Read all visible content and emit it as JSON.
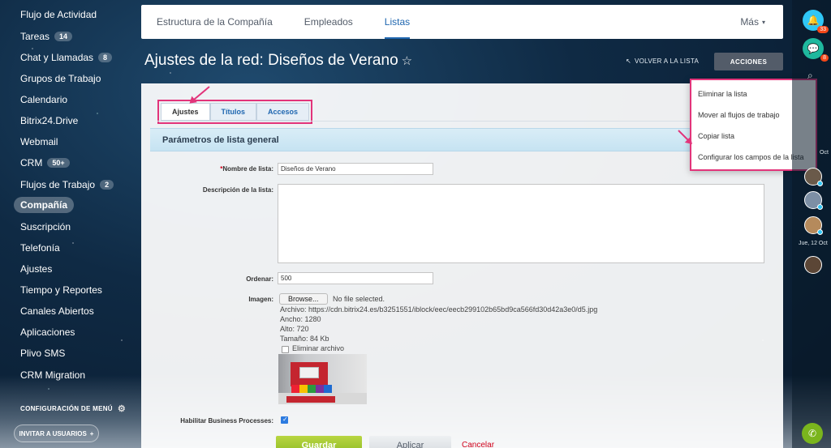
{
  "sidebar": {
    "items": [
      {
        "label": "Flujo de Actividad",
        "badge": ""
      },
      {
        "label": "Tareas",
        "badge": "14"
      },
      {
        "label": "Chat y Llamadas",
        "badge": "8"
      },
      {
        "label": "Grupos de Trabajo",
        "badge": ""
      },
      {
        "label": "Calendario",
        "badge": ""
      },
      {
        "label": "Bitrix24.Drive",
        "badge": ""
      },
      {
        "label": "Webmail",
        "badge": ""
      },
      {
        "label": "CRM",
        "badge": "50+"
      },
      {
        "label": "Flujos de Trabajo",
        "badge": "2"
      },
      {
        "label": "Compañía",
        "badge": ""
      },
      {
        "label": "Suscripción",
        "badge": ""
      },
      {
        "label": "Telefonía",
        "badge": ""
      },
      {
        "label": "Ajustes",
        "badge": ""
      },
      {
        "label": "Tiempo y Reportes",
        "badge": ""
      },
      {
        "label": "Canales Abiertos",
        "badge": ""
      },
      {
        "label": "Aplicaciones",
        "badge": ""
      },
      {
        "label": "Plivo SMS",
        "badge": ""
      },
      {
        "label": "CRM Migration",
        "badge": ""
      }
    ],
    "active_index": 9,
    "menu_settings": "CONFIGURACIÓN DE MENÚ",
    "invite": "INVITAR A USUARIOS",
    "invite_plus": "+"
  },
  "topnav": {
    "tabs": [
      "Estructura de la Compañía",
      "Empleados",
      "Listas"
    ],
    "active_index": 2,
    "more": "Más",
    "more_caret": "▾"
  },
  "header": {
    "title": "Ajustes de la red: Diseños de Verano",
    "star": "☆",
    "back_link": "VOLVER A LA LISTA",
    "back_icon": "↖",
    "actions": "ACCIONES"
  },
  "form": {
    "tabs": [
      "Ajustes",
      "Títulos",
      "Accesos"
    ],
    "active_tab": 0,
    "section_title": "Parámetros de lista general",
    "name_required_mark": "*",
    "name_label": "Nombre de lista:",
    "name_value": "Diseños de Verano",
    "description_label": "Descripción de la lista:",
    "description_value": "",
    "sort_label": "Ordenar:",
    "sort_value": "500",
    "image_label": "Imagen:",
    "browse": "Browse...",
    "no_file": "No file selected.",
    "file_info": "Archivo: https://cdn.bitrix24.es/b3251551/iblock/eec/eecb299102b65bd9ca566fd30d42a3e0/d5.jpg",
    "width": "Ancho: 1280",
    "height": "Alto: 720",
    "size": "Tamaño: 84 Kb",
    "delete_file": "Eliminar archivo",
    "delete_checked": false,
    "bp_label": "Habilitar Business Processes:",
    "bp_checked": true,
    "save": "Guardar",
    "apply": "Aplicar",
    "cancel": "Cancelar"
  },
  "dropdown": {
    "items": [
      "Eliminar la lista",
      "Mover al flujos de trabajo",
      "Copiar lista",
      "Configurar los campos de la lista"
    ]
  },
  "rail": {
    "notifications_badge": "33",
    "chat_badge": "8",
    "date1": "Oct",
    "date2": "Jue, 12 Oct"
  },
  "colors": {
    "accent": "#2067b0",
    "highlight": "#e2347a",
    "save_green": "#8cba22",
    "actions_bg": "#535c69"
  }
}
